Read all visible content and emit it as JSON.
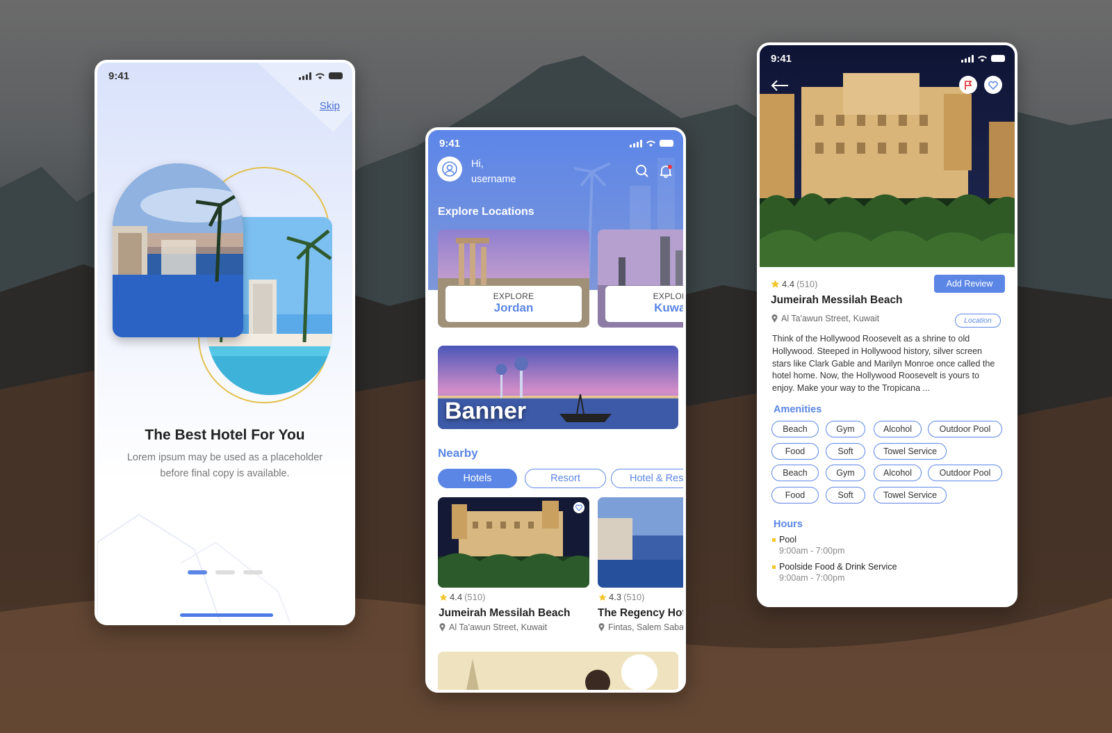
{
  "status_time": "9:41",
  "onboarding": {
    "skip_label": "Skip",
    "title": "The Best Hotel For You",
    "subtitle": "Lorem ipsum may be used as a placeholder before final copy is available."
  },
  "home": {
    "greeting": "Hi,",
    "username": "username",
    "explore_title": "Explore Locations",
    "locations": [
      {
        "kicker": "EXPLORE",
        "name": "Jordan"
      },
      {
        "kicker": "EXPLORE",
        "name": "Kuwait"
      }
    ],
    "banner_text": "Banner",
    "nearby_title": "Nearby",
    "filters": [
      "Hotels",
      "Resort",
      "Hotel & Resort"
    ],
    "hotels": [
      {
        "rating": "4.4",
        "reviews": "(510)",
        "name": "Jumeirah Messilah Beach",
        "address": "Al Ta'awun Street, Kuwait"
      },
      {
        "rating": "4.3",
        "reviews": "(510)",
        "name": "The Regency Hotel",
        "address": "Fintas, Salem Sabah"
      }
    ]
  },
  "detail": {
    "add_review_label": "Add Review",
    "rating": "4.4",
    "reviews": "(510)",
    "name": "Jumeirah Messilah Beach",
    "address": "Al Ta'awun Street, Kuwait",
    "location_label": "Location",
    "description": "Think of the Hollywood Roosevelt as a shrine to old Hollywood. Steeped in Hollywood history, silver screen stars like Clark Gable and Marilyn Monroe once called the hotel home. Now, the Hollywood Roosevelt is yours to enjoy. Make your way to the Tropicana ...",
    "amenities_title": "Amenities",
    "amenities": [
      "Beach",
      "Gym",
      "Alcohol",
      "Outdoor Pool",
      "Food",
      "Soft",
      "Towel Service",
      "Beach",
      "Gym",
      "Alcohol",
      "Outdoor Pool",
      "Food",
      "Soft",
      "Towel Service"
    ],
    "hours_title": "Hours",
    "hours": [
      {
        "name": "Pool",
        "time": "9:00am - 7:00pm"
      },
      {
        "name": "Poolside Food & Drink Service",
        "time": "9:00am - 7:00pm"
      }
    ]
  },
  "colors": {
    "accent": "#5b86e5",
    "star": "#f3c528",
    "ring": "#e3c04a"
  }
}
